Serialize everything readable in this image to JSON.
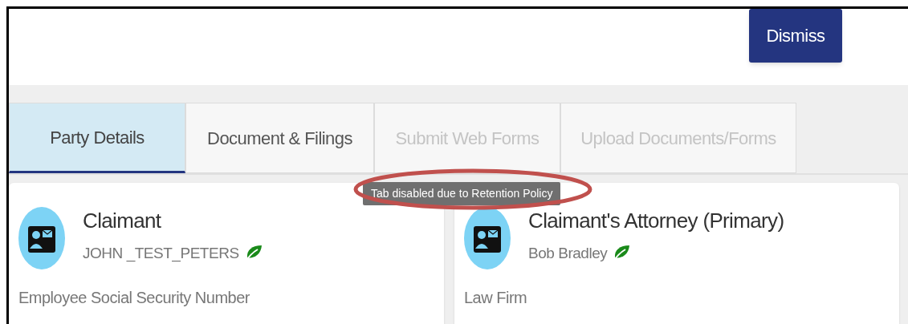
{
  "header": {
    "button": "Dismiss"
  },
  "tabs": [
    {
      "label": "Party Details",
      "selected": true,
      "disabled": false
    },
    {
      "label": "Document & Filings",
      "selected": false,
      "disabled": false
    },
    {
      "label": "Submit Web Forms",
      "selected": false,
      "disabled": true
    },
    {
      "label": "Upload Documents/Forms",
      "selected": false,
      "disabled": true
    }
  ],
  "tooltip": "Tab disabled due to Retention Policy",
  "parties": [
    {
      "title": "Claimant",
      "name": "JOHN _TEST_PETERS",
      "field": "Employee Social Security Number"
    },
    {
      "title": "Claimant's Attorney (Primary)",
      "name": "Bob Bradley",
      "field": "Law Firm"
    }
  ]
}
